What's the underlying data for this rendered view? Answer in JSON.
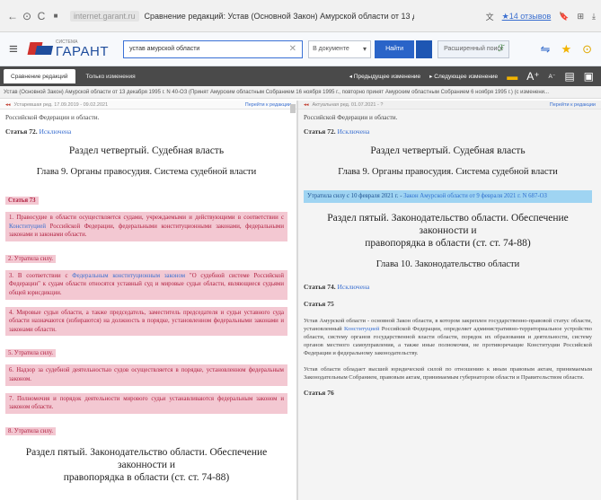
{
  "browser": {
    "nav_icons": [
      "back-icon",
      "forward-icon",
      "reload-icon"
    ],
    "back": "←",
    "forward": "⊙",
    "reload": "C",
    "lock": "■",
    "domain": "internet.garant.ru",
    "tab_title": "Сравнение редакций: Устав (Основной Закон) Амурской области от 13 декабря 1...",
    "reviews": "★14 отзывов",
    "right_icons": [
      "translate-icon",
      "bookmark-icon",
      "collections-icon",
      "download-icon"
    ],
    "translate": "文",
    "bookmark": "🔖",
    "menu": "⊞",
    "download": "⤓"
  },
  "toolbar": {
    "menu_glyph": "≡",
    "logo_small": "СИСТЕМА",
    "logo_big": "ГАРАНТ",
    "search_value": "устав амурской области",
    "clear_glyph": "✕",
    "scope": "В документе",
    "scope_chev": "▾",
    "find": "Найти",
    "advanced": "Расширенный поиск",
    "advanced_icon": "ℱ",
    "icons": {
      "compare": "⇋",
      "favorite": "★",
      "help": "⊙"
    }
  },
  "tabs": {
    "items": [
      "Сравнение редакций",
      "Только изменения"
    ],
    "prev_change": "Предыдущее изменение",
    "next_change": "Следующее изменение",
    "font_larger": "A⁺",
    "font_smaller": "A⁻",
    "print": "▤",
    "save": "▣"
  },
  "doc_title": "Устав (Основной Закон) Амурской области от 13 декабря 1995 г. N 40-ОЗ (Принят Амурским областным Собранием 16 ноября 1995 г., повторно принят Амурским областным Собранием 6 ноября 1995 г.) (с изменени...",
  "left": {
    "edition": "Устаревшая ред. 17.09.2019 - 09.02.2021",
    "edition_marker": "◂◂",
    "goto": "Перейти к редакции",
    "top_text": "Российской Федерации и области.",
    "art72": "Статья 72.",
    "art72_ex": "Исключена",
    "section4": "Раздел четвертый. Судебная власть",
    "chapter9": "Глава 9. Органы правосудия. Система судебной власти",
    "art73": "Статья 73",
    "p1": "1. Правосудие в области осуществляется судами, учреждаемыми и действующими в соответствии с",
    "p1_link": "Конституцией",
    "p1_tail": "Российской Федерации, федеральными конституционными законами, федеральными законами и законами области.",
    "p2": "2. Утратила силу.",
    "p3_head": "3. В соответствии с",
    "p3_link": "Федеральным конституционным законом",
    "p3_tail": "\"О судебной системе Российской Федерации\" к судам области относятся уставный суд и мировые судьи области, являющиеся судьями общей юрисдикции.",
    "p4": "4. Мировые судьи области, а также председатель, заместитель председателя и судьи уставного суда области назначаются (избираются) на должность в порядке, установленном федеральными законами и законами области.",
    "p5": "5. Утратила силу.",
    "p6": "6. Надзор за судебной деятельностью судов осуществляется в порядке, установленном федеральным законом.",
    "p7": "7. Полномочия и порядок деятельности мирового судьи устанавливаются федеральным законом и законом области.",
    "p8": "8. Утратила силу.",
    "section5_a": "Раздел пятый. Законодательство области. Обеспечение законности и",
    "section5_b": "правопорядка в области (ст. ст. 74-88)"
  },
  "right": {
    "edition": "Актуальная ред. 01.07.2021 - ?",
    "edition_marker": "◂◂",
    "goto": "Перейти к редакции",
    "top_text": "Российской Федерации и области.",
    "art72": "Статья 72.",
    "art72_ex": "Исключена",
    "section4": "Раздел четвертый. Судебная власть",
    "chapter9": "Глава 9. Органы правосудия. Система судебной власти",
    "lost": "Утратила силу с 10 февраля 2021 г. -",
    "lost_link": "Закон Амурской области от 9 февраля 2021 г. N 687-ОЗ",
    "section5_a": "Раздел пятый. Законодательство области. Обеспечение законности и",
    "section5_b": "правопорядка в области (ст. ст. 74-88)",
    "chapter10": "Глава 10. Законодательство области",
    "art74": "Статья 74.",
    "art74_ex": "Исключена",
    "art75": "Статья 75",
    "art75_p1_a": "Устав Амурской области - основной Закон области, в котором закреплен государственно-правовой статус области, установленный",
    "art75_p1_link": "Конституцией",
    "art75_p1_b": "Российской Федерации, определяет административно-территориальное устройство области, систему органов государственной власти области, порядок их образования и деятельности, систему органов местного самоуправления, а также иные полномочия, не противоречащие Конституции Российской Федерации и федеральному законодательству.",
    "art75_p2": "Устав области обладает высшей юридической силой по отношению к иным правовым актам, принимаемым Законодательным Собранием, правовым актам, принимаемым губернатором области и Правительством области.",
    "art76": "Статья 76"
  }
}
